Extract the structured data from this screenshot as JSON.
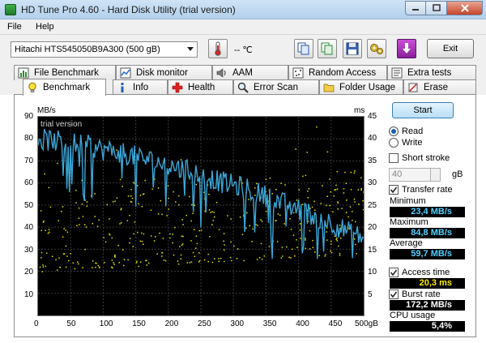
{
  "window": {
    "title": "HD Tune Pro 4.60 - Hard Disk Utility (trial version)"
  },
  "menu": {
    "file": "File",
    "help": "Help"
  },
  "toolbar": {
    "drive": "Hitachi HTS545050B9A300  (500 gB)",
    "temperature": "-- ℃",
    "exit_label": "Exit"
  },
  "tabs_top": [
    {
      "label": "File Benchmark"
    },
    {
      "label": "Disk monitor"
    },
    {
      "label": "AAM"
    },
    {
      "label": "Random Access"
    },
    {
      "label": "Extra tests"
    }
  ],
  "tabs_bottom": [
    {
      "label": "Benchmark"
    },
    {
      "label": "Info"
    },
    {
      "label": "Health"
    },
    {
      "label": "Error Scan"
    },
    {
      "label": "Folder Usage"
    },
    {
      "label": "Erase"
    }
  ],
  "graph": {
    "left_unit": "MB/s",
    "right_unit": "ms",
    "watermark": "trial version",
    "left_ticks": [
      "90",
      "80",
      "70",
      "60",
      "50",
      "40",
      "30",
      "20",
      "10"
    ],
    "right_ticks": [
      "45",
      "40",
      "35",
      "30",
      "25",
      "20",
      "15",
      "10",
      "5"
    ],
    "x_ticks": [
      "0",
      "50",
      "100",
      "150",
      "200",
      "250",
      "300",
      "350",
      "400",
      "450",
      "500gB"
    ]
  },
  "chart_data": {
    "type": "line",
    "x_range_gb": [
      0,
      500
    ],
    "y_left_range_mbs": [
      0,
      90
    ],
    "y_right_range_ms": [
      0,
      45
    ],
    "grid": true,
    "series": [
      {
        "color": "#3aa7d8",
        "axis": "left",
        "x": [
          0,
          25,
          50,
          75,
          100,
          125,
          150,
          175,
          200,
          225,
          250,
          275,
          300,
          325,
          350,
          375,
          400,
          425,
          450,
          475,
          500
        ],
        "values": [
          80,
          79,
          78,
          77,
          75,
          74,
          72,
          70,
          68,
          66,
          64,
          61,
          59,
          57,
          54,
          51,
          48,
          45,
          42,
          38,
          35
        ]
      },
      {
        "color": "#e6e600",
        "axis": "right",
        "kind": "scatter",
        "mean_ms": 20.3,
        "spread_ms": [
          10,
          30
        ]
      }
    ]
  },
  "side": {
    "start_label": "Start",
    "read_label": "Read",
    "write_label": "Write",
    "short_stroke_label": "Short stroke",
    "short_stroke_value": "40",
    "gb_label": "gB",
    "transfer_rate_label": "Transfer rate",
    "minimum_label": "Minimum",
    "minimum_value": "23,4 MB/s",
    "maximum_label": "Maximum",
    "maximum_value": "84,8 MB/s",
    "average_label": "Average",
    "average_value": "59,7 MB/s",
    "access_time_label": "Access time",
    "access_time_value": "20,3 ms",
    "burst_rate_label": "Burst rate",
    "burst_rate_value": "172,2 MB/s",
    "cpu_usage_label": "CPU usage",
    "cpu_usage_value": "5,4%"
  },
  "colors": {
    "accent": "#3aa7d8",
    "access_dots": "#e6e600",
    "graph_bg": "#000000",
    "value_text": "#4fd1ff"
  }
}
